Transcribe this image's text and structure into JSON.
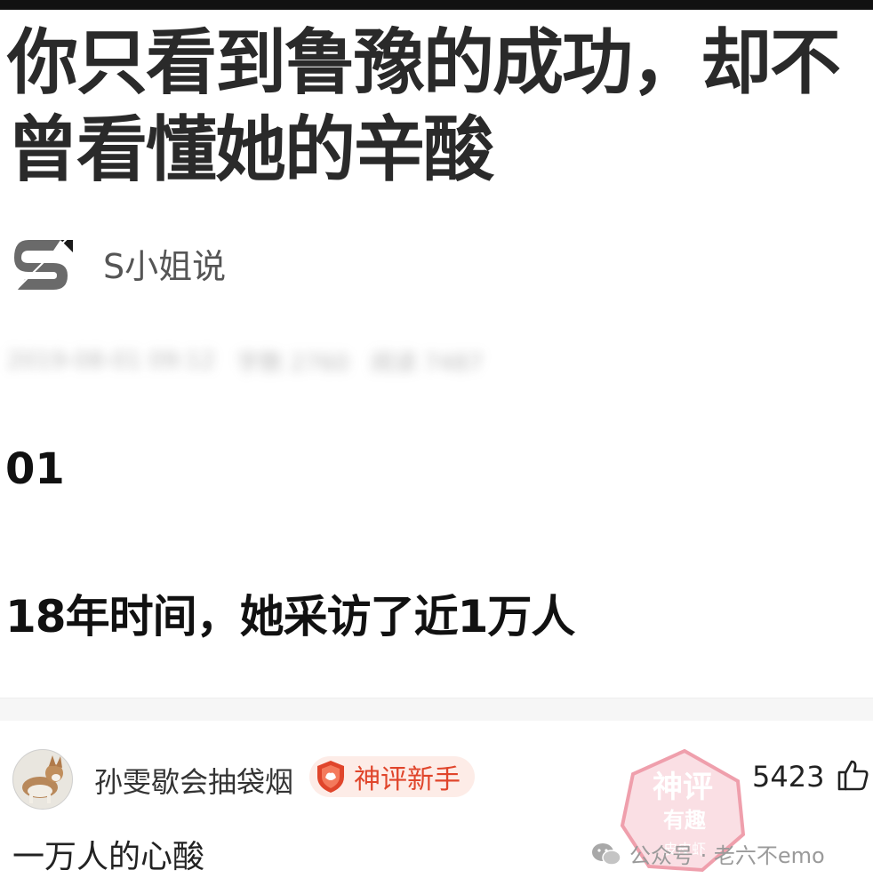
{
  "article": {
    "title": "你只看到鲁豫的成功，却不曾看懂她的辛酸",
    "author": "S小姐说",
    "meta": [
      "2019-08-01 09:12",
      "字数 2760",
      "阅读 7487"
    ],
    "section_number": "01",
    "lead": "18年时间，她采访了近1万人"
  },
  "comment": {
    "username": "孙雯歇会抽袋烟",
    "badge": "神评新手",
    "likes": "5423",
    "text": "一万人的心酸",
    "stamp_line1": "神评",
    "stamp_line2": "有趣",
    "stamp_line3": "皮皮虾",
    "watermark": "公众号 · 老六不emo"
  },
  "colors": {
    "badge_bg": "#fdece7",
    "badge_text": "#e0452b",
    "stamp": "#e3526a"
  }
}
